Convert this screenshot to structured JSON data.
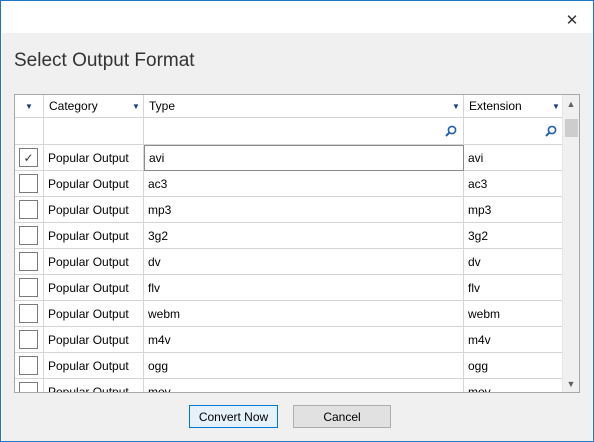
{
  "dialog": {
    "title": "Select Output Format",
    "close_glyph": "✕"
  },
  "grid": {
    "columns": [
      {
        "key": "check",
        "label": ""
      },
      {
        "key": "category",
        "label": "Category"
      },
      {
        "key": "type",
        "label": "Type"
      },
      {
        "key": "extension",
        "label": "Extension"
      }
    ],
    "rows": [
      {
        "checked": true,
        "category": "Popular Output",
        "type": "avi",
        "extension": "avi"
      },
      {
        "checked": false,
        "category": "Popular Output",
        "type": "ac3",
        "extension": "ac3"
      },
      {
        "checked": false,
        "category": "Popular Output",
        "type": "mp3",
        "extension": "mp3"
      },
      {
        "checked": false,
        "category": "Popular Output",
        "type": "3g2",
        "extension": "3g2"
      },
      {
        "checked": false,
        "category": "Popular Output",
        "type": "dv",
        "extension": "dv"
      },
      {
        "checked": false,
        "category": "Popular Output",
        "type": "flv",
        "extension": "flv"
      },
      {
        "checked": false,
        "category": "Popular Output",
        "type": "webm",
        "extension": "webm"
      },
      {
        "checked": false,
        "category": "Popular Output",
        "type": "m4v",
        "extension": "m4v"
      },
      {
        "checked": false,
        "category": "Popular Output",
        "type": "ogg",
        "extension": "ogg"
      },
      {
        "checked": false,
        "category": "Popular Output",
        "type": "mov",
        "extension": "mov"
      }
    ],
    "selected_cell": {
      "row": 0,
      "column": "type"
    },
    "icons": {
      "sort_arrow": "chevron-down-icon",
      "filter": "search-icon",
      "check": "checkmark-icon"
    }
  },
  "buttons": {
    "convert": "Convert Now",
    "cancel": "Cancel"
  },
  "colors": {
    "accent": "#0078d7",
    "window_border": "#1f74c7",
    "filter_icon": "#1f5fb0"
  }
}
